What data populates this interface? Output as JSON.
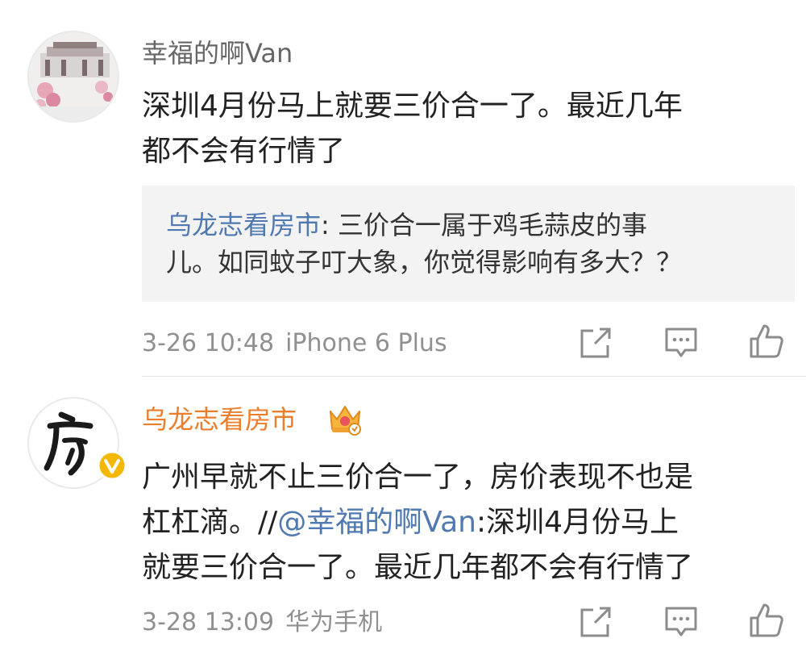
{
  "colors": {
    "username_gray": "#666666",
    "username_vip": "#eb7d2b",
    "mention_blue": "#4f79b0",
    "meta_gray": "#909090",
    "quote_bg": "#f3f3f3",
    "verified_badge": "#f5b800"
  },
  "comments": [
    {
      "username": "幸福的啊Van",
      "avatar_icon": "landscape-avatar-icon",
      "text_lines": [
        "深圳4月份马上就要三价合一了。最近几年",
        "都不会有行情了"
      ],
      "quote": {
        "author": "乌龙志看房市",
        "separator": ":",
        "line1_rest": " 三价合一属于鸡毛蒜皮的事",
        "line2": "儿。如同蚊子叮大象，你觉得影响有多大？？"
      },
      "time": "3-26 10:48",
      "device": "iPhone 6 Plus",
      "actions": [
        "share-icon",
        "comment-icon",
        "like-icon"
      ]
    },
    {
      "username": "乌龙志看房市",
      "avatar_icon": "fang-character-avatar-icon",
      "badge_icon": "vip-crown-icon",
      "verified_icon": "verified-v-icon",
      "text_line1": "广州早就不止三价合一了，房价表现不也是",
      "text_line2_pre": "杠杠滴。//",
      "text_line2_mention": "@幸福的啊Van",
      "text_line2_post": ":深圳4月份马上",
      "text_line3": "就要三价合一了。最近几年都不会有行情了",
      "time": "3-28 13:09",
      "device": "华为手机",
      "actions": [
        "share-icon",
        "comment-icon",
        "like-icon"
      ]
    }
  ]
}
